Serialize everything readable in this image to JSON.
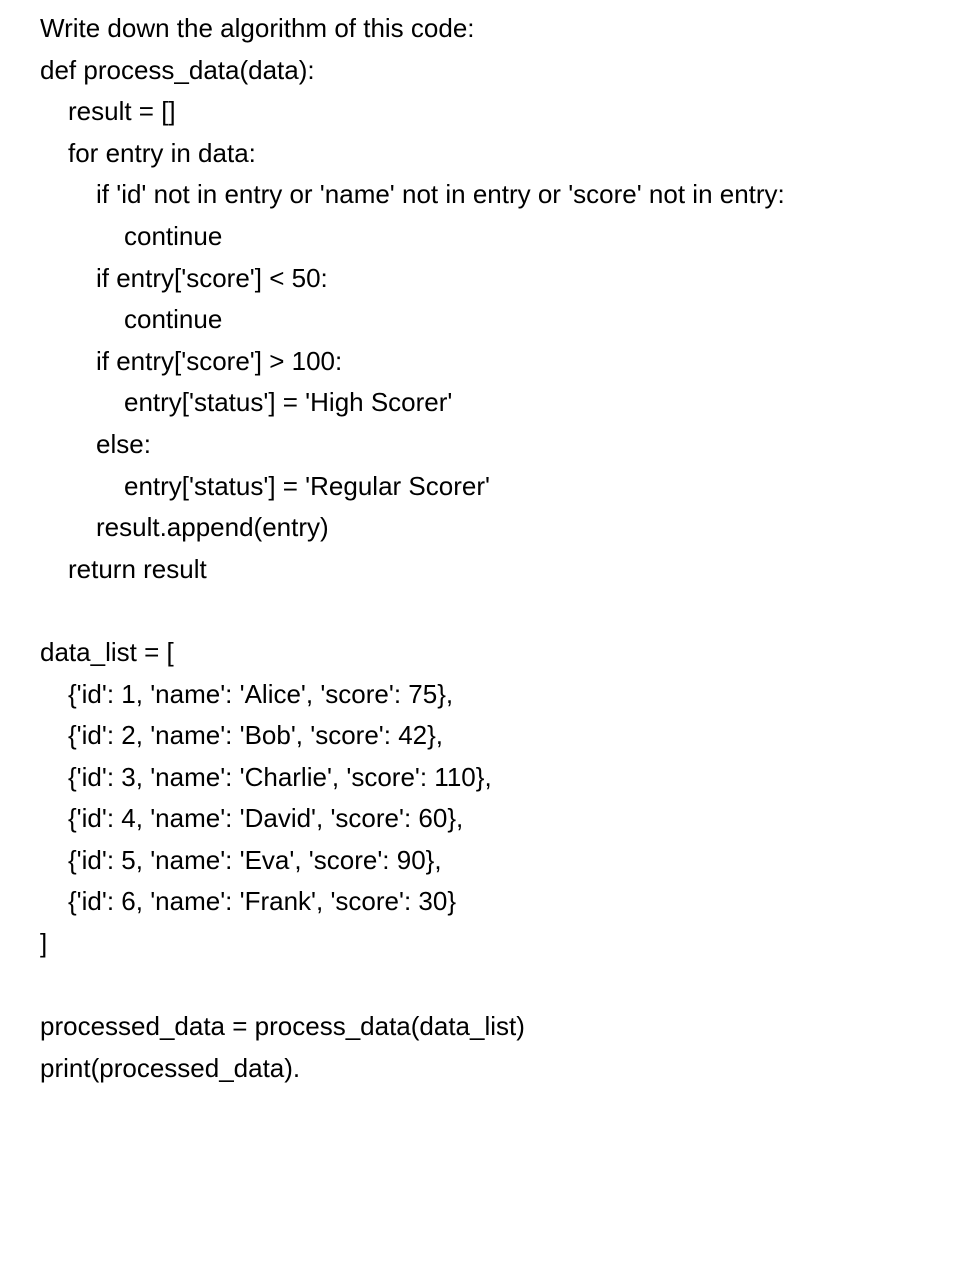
{
  "lines": [
    {
      "indent": 0,
      "text": "Write down the algorithm of this code:"
    },
    {
      "indent": 0,
      "text": "def process_data(data):"
    },
    {
      "indent": 1,
      "text": "result = []"
    },
    {
      "indent": 1,
      "text": "for entry in data:"
    },
    {
      "indent": 2,
      "text": "if 'id' not in entry or 'name' not in entry or 'score' not in entry:"
    },
    {
      "indent": 3,
      "text": "continue"
    },
    {
      "indent": 2,
      "text": "if entry['score'] < 50:"
    },
    {
      "indent": 3,
      "text": "continue"
    },
    {
      "indent": 2,
      "text": "if entry['score'] > 100:"
    },
    {
      "indent": 3,
      "text": "entry['status'] = 'High Scorer'"
    },
    {
      "indent": 2,
      "text": "else:"
    },
    {
      "indent": 3,
      "text": "entry['status'] = 'Regular Scorer'"
    },
    {
      "indent": 2,
      "text": "result.append(entry)"
    },
    {
      "indent": 1,
      "text": "return result"
    },
    {
      "indent": 0,
      "text": "",
      "blank": true
    },
    {
      "indent": 0,
      "text": "data_list = ["
    },
    {
      "indent": 1,
      "text": "{'id': 1, 'name': 'Alice', 'score': 75},"
    },
    {
      "indent": 1,
      "text": "{'id': 2, 'name': 'Bob', 'score': 42},"
    },
    {
      "indent": 1,
      "text": "{'id': 3, 'name': 'Charlie', 'score': 110},"
    },
    {
      "indent": 1,
      "text": "{'id': 4, 'name': 'David', 'score': 60},"
    },
    {
      "indent": 1,
      "text": "{'id': 5, 'name': 'Eva', 'score': 90},"
    },
    {
      "indent": 1,
      "text": "{'id': 6, 'name': 'Frank', 'score': 30}"
    },
    {
      "indent": 0,
      "text": "]"
    },
    {
      "indent": 0,
      "text": "",
      "blank": true
    },
    {
      "indent": 0,
      "text": "processed_data = process_data(data_list)"
    },
    {
      "indent": 0,
      "text": "print(processed_data)."
    }
  ]
}
